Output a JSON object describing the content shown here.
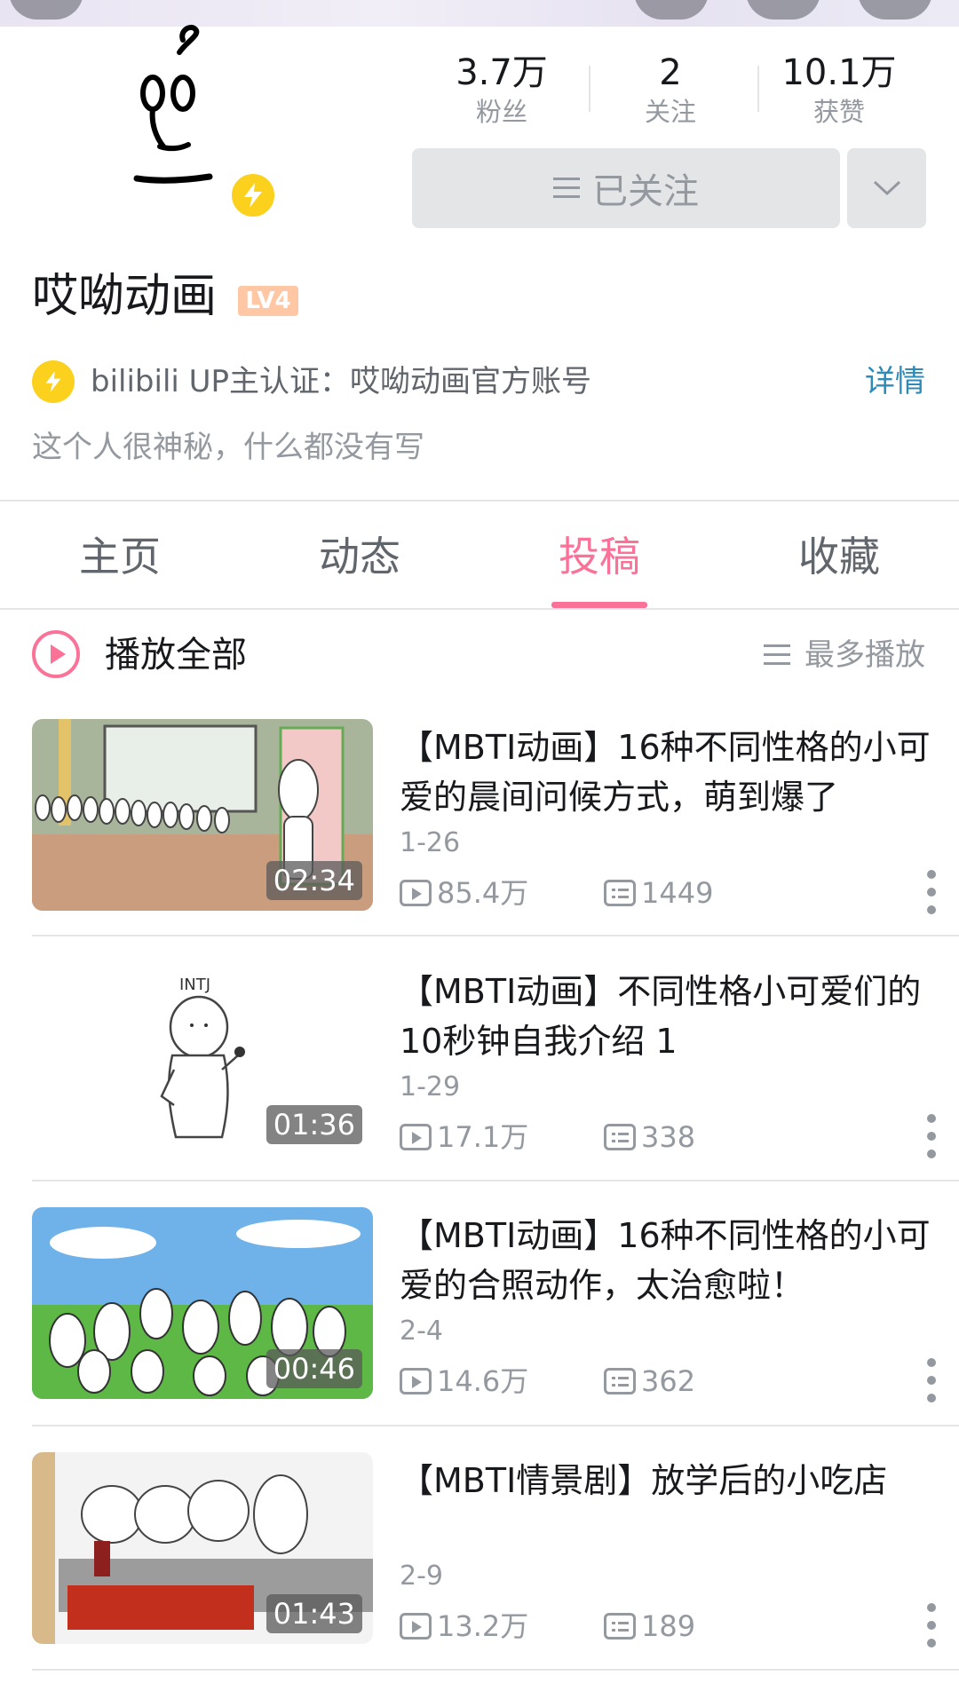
{
  "profile": {
    "name": "哎呦动画",
    "level": "LV4",
    "stats": [
      {
        "value": "3.7万",
        "label": "粉丝"
      },
      {
        "value": "2",
        "label": "关注"
      },
      {
        "value": "10.1万",
        "label": "获赞"
      }
    ],
    "follow_label": "已关注",
    "cert_text": "bilibili UP主认证：哎呦动画官方账号",
    "cert_detail": "详情",
    "bio": "这个人很神秘，什么都没有写"
  },
  "tabs": [
    {
      "label": "主页",
      "active": false
    },
    {
      "label": "动态",
      "active": false
    },
    {
      "label": "投稿",
      "active": true
    },
    {
      "label": "收藏",
      "active": false
    }
  ],
  "list": {
    "play_all_label": "播放全部",
    "sort_label": "最多播放"
  },
  "videos": [
    {
      "title": "【MBTI动画】16种不同性格的小可爱的晨间问候方式，萌到爆了",
      "date": "1-26",
      "duration": "02:34",
      "views": "85.4万",
      "danmaku": "1449"
    },
    {
      "title": "【MBTI动画】不同性格小可爱们的10秒钟自我介绍 1",
      "date": "1-29",
      "duration": "01:36",
      "views": "17.1万",
      "danmaku": "338"
    },
    {
      "title": "【MBTI动画】16种不同性格的小可爱的合照动作，太治愈啦！",
      "date": "2-4",
      "duration": "00:46",
      "views": "14.6万",
      "danmaku": "362"
    },
    {
      "title": "【MBTI情景剧】放学后的小吃店",
      "date": "2-9",
      "duration": "01:43",
      "views": "13.2万",
      "danmaku": "189"
    }
  ],
  "colors": {
    "accent": "#fb7299",
    "link": "#2e8bb8",
    "badge": "#fbd11e"
  }
}
